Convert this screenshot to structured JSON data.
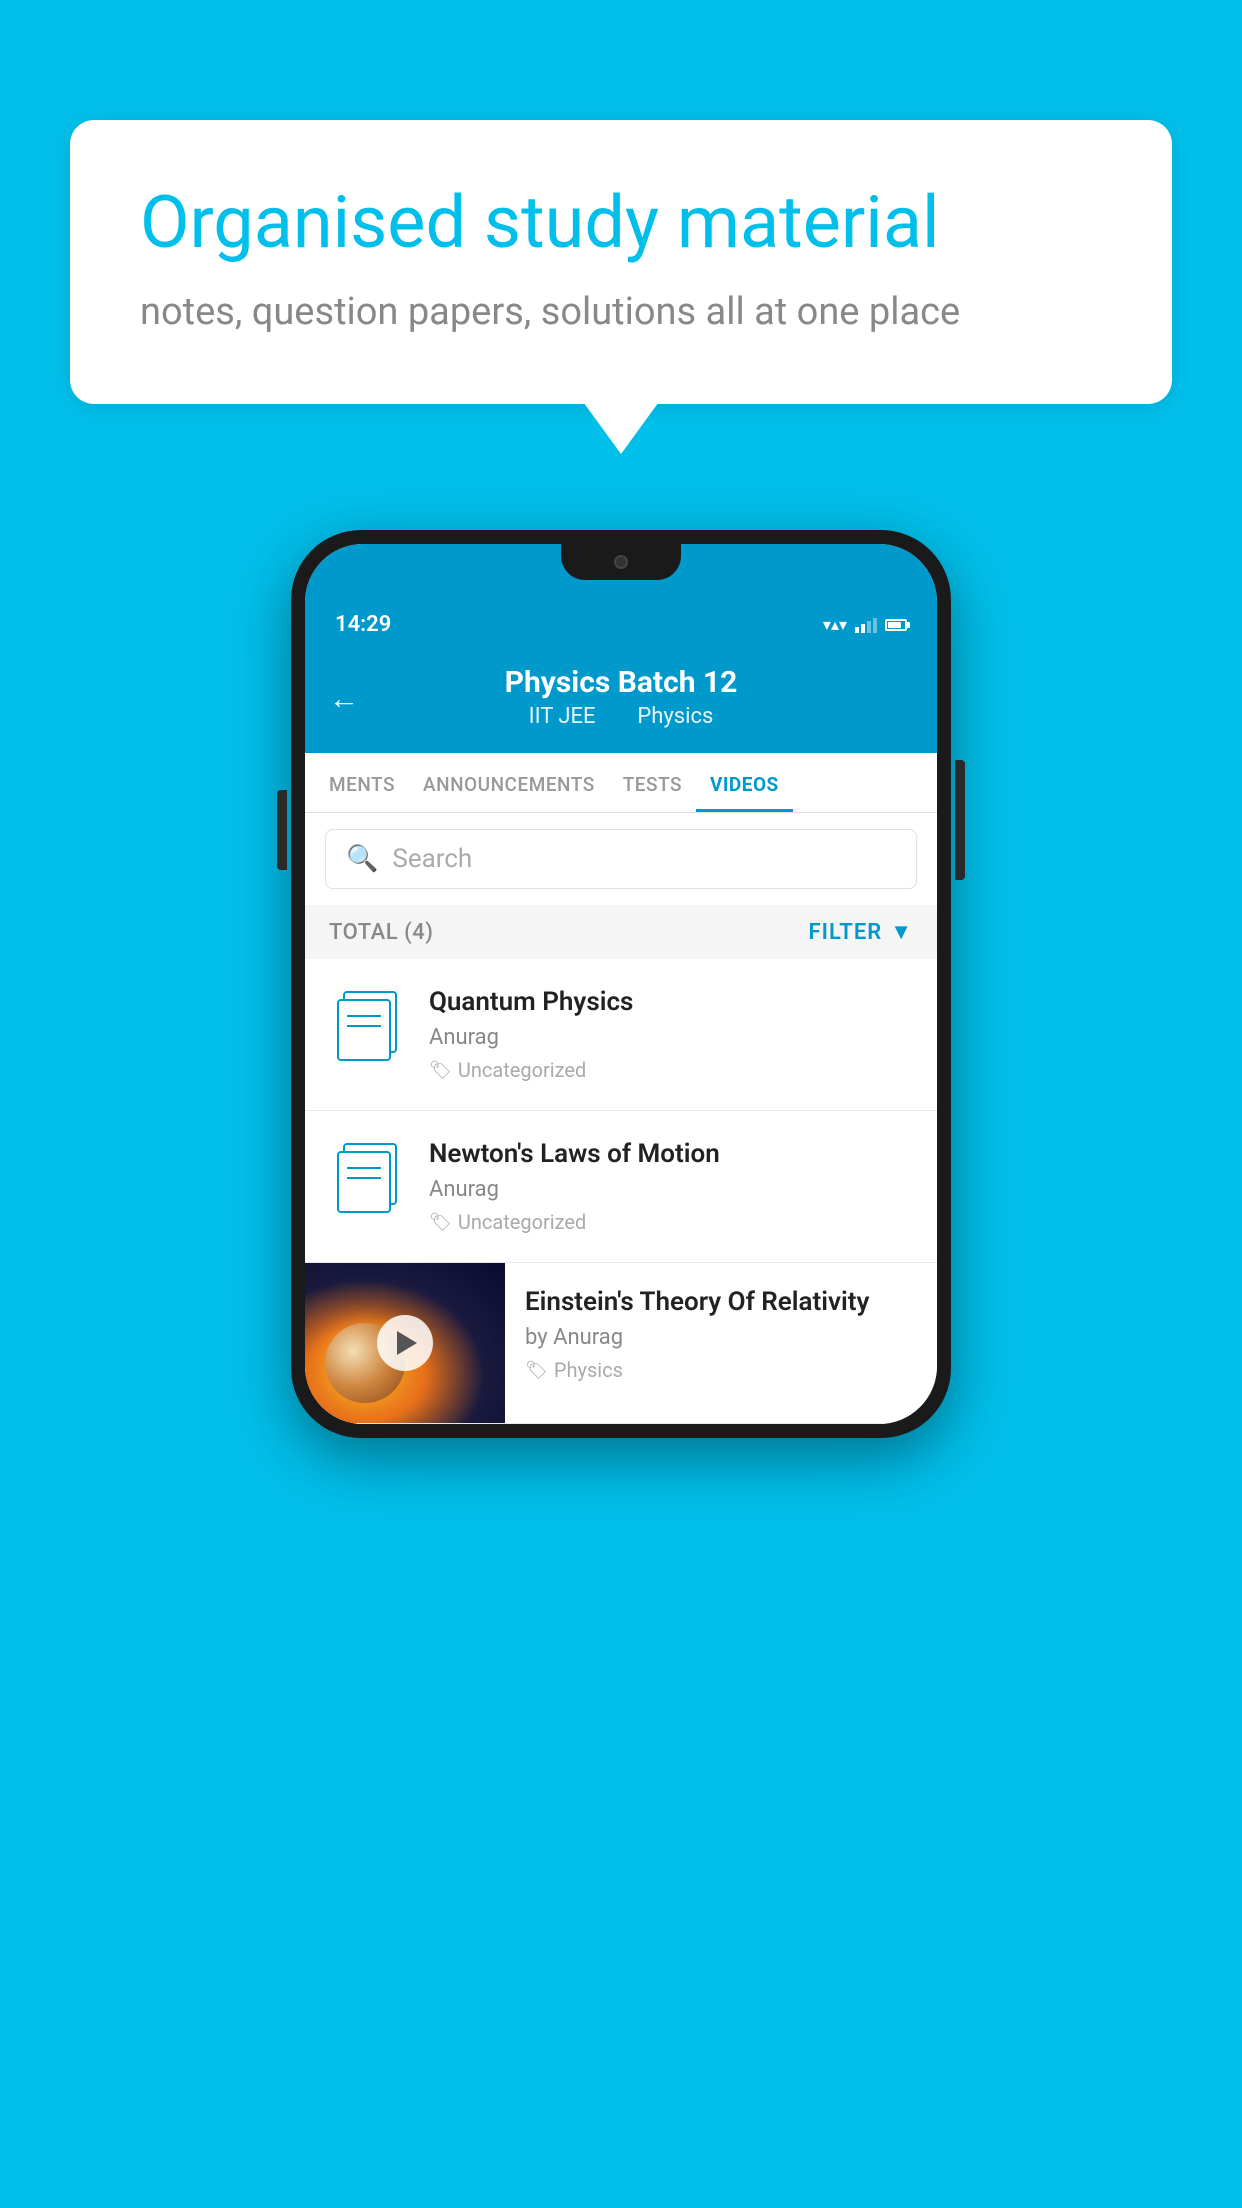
{
  "app": {
    "background_color": "#00BFEA"
  },
  "hero": {
    "bubble_title": "Organised study material",
    "bubble_subtitle": "notes, question papers, solutions all at one place"
  },
  "phone": {
    "status_bar": {
      "time": "14:29"
    },
    "header": {
      "title": "Physics Batch 12",
      "subtitle_part1": "IIT JEE",
      "subtitle_part2": "Physics",
      "back_label": "←"
    },
    "tabs": [
      {
        "label": "MENTS",
        "active": false
      },
      {
        "label": "ANNOUNCEMENTS",
        "active": false
      },
      {
        "label": "TESTS",
        "active": false
      },
      {
        "label": "VIDEOS",
        "active": true
      }
    ],
    "search": {
      "placeholder": "Search"
    },
    "filter_bar": {
      "total_label": "TOTAL (4)",
      "filter_label": "FILTER"
    },
    "videos": [
      {
        "id": 1,
        "title": "Quantum Physics",
        "author": "Anurag",
        "tag": "Uncategorized",
        "has_thumbnail": false
      },
      {
        "id": 2,
        "title": "Newton's Laws of Motion",
        "author": "Anurag",
        "tag": "Uncategorized",
        "has_thumbnail": false
      },
      {
        "id": 3,
        "title": "Einstein's Theory Of Relativity",
        "author": "by Anurag",
        "tag": "Physics",
        "has_thumbnail": true
      }
    ]
  }
}
